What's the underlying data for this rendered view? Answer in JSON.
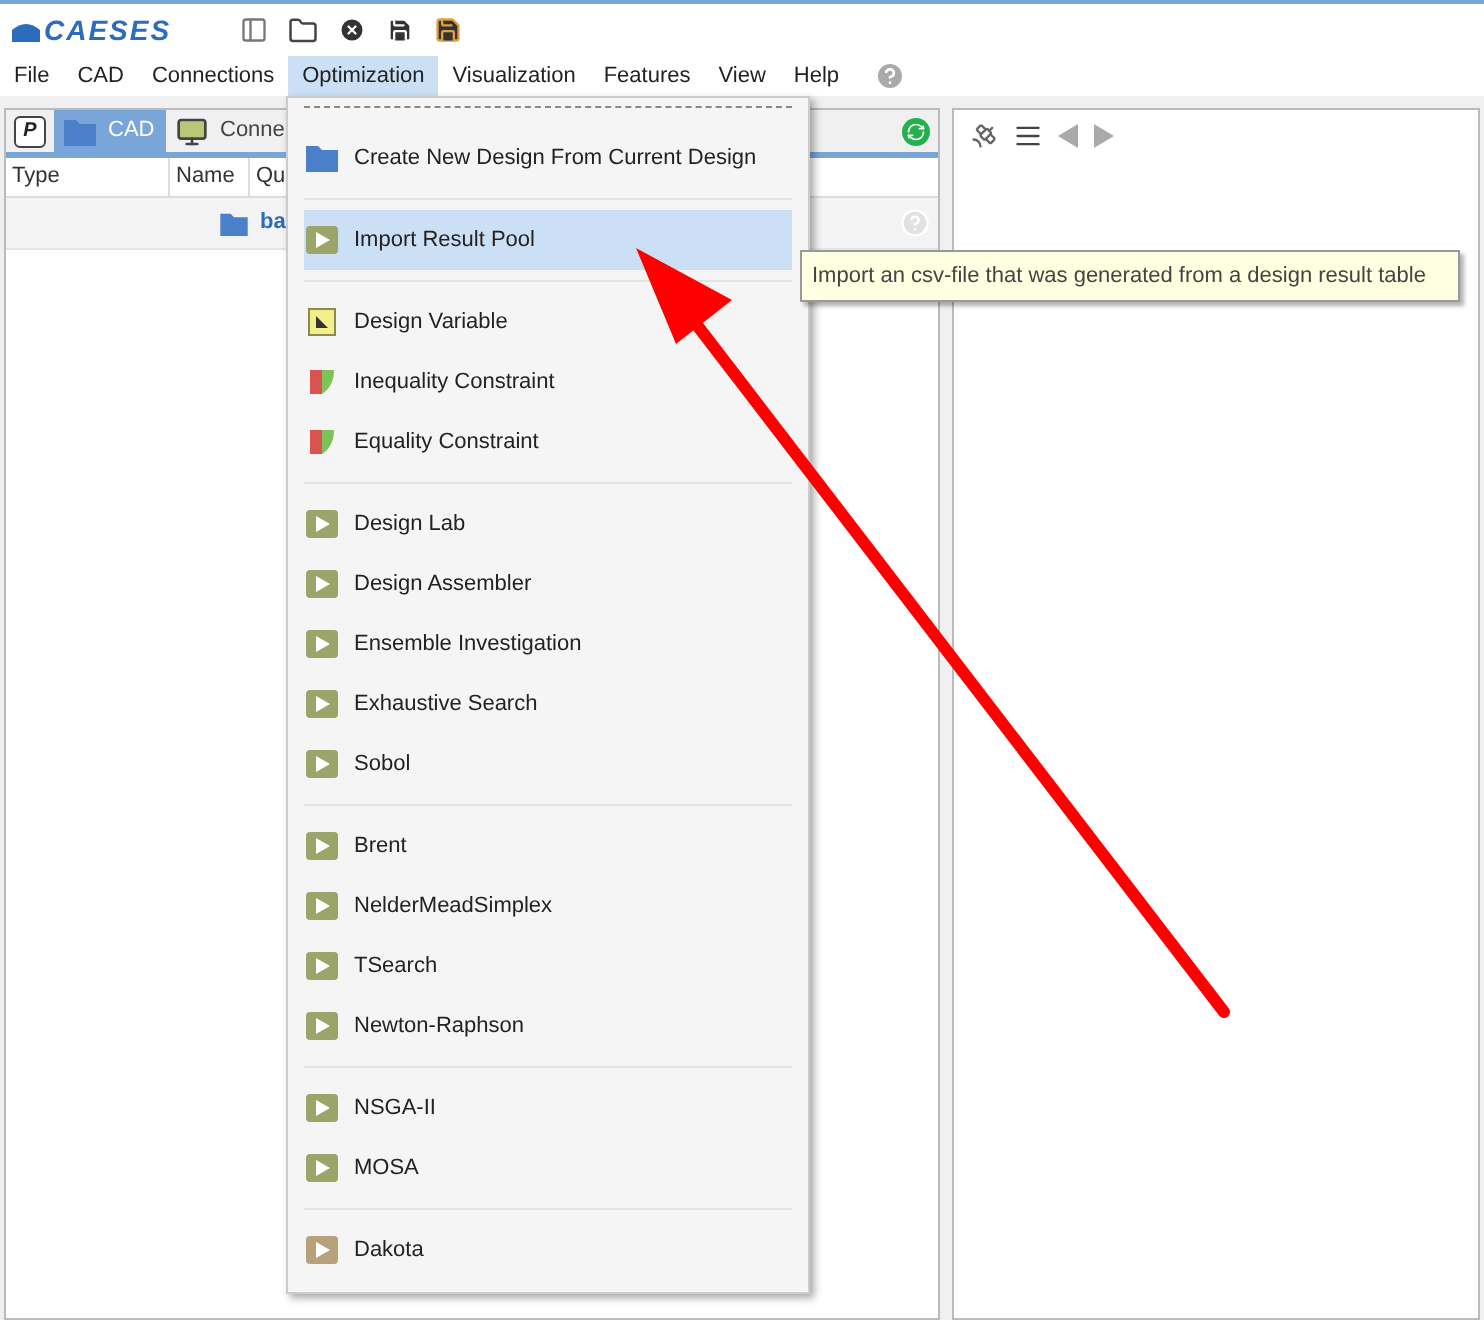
{
  "logo": "CAESES",
  "menubar": [
    {
      "label": "File",
      "selected": false
    },
    {
      "label": "CAD",
      "selected": false
    },
    {
      "label": "Connections",
      "selected": false
    },
    {
      "label": "Optimization",
      "selected": true
    },
    {
      "label": "Visualization",
      "selected": false
    },
    {
      "label": "Features",
      "selected": false
    },
    {
      "label": "View",
      "selected": false
    },
    {
      "label": "Help",
      "selected": false
    }
  ],
  "left_panel": {
    "p_button": "P",
    "tabs": [
      {
        "label": "CAD",
        "selected": true,
        "kind": "folder"
      },
      {
        "label": "Conne",
        "selected": false,
        "kind": "monitor"
      }
    ],
    "columns": [
      "Type",
      "Name",
      "Qu"
    ],
    "rows": [
      {
        "name": "ba"
      }
    ]
  },
  "menu": {
    "groups": [
      [
        {
          "label": "Create New Design From Current Design",
          "kind": "folder",
          "selected": false
        }
      ],
      [
        {
          "label": "Import Result Pool",
          "kind": "play",
          "color": "#9aa56a",
          "selected": true
        }
      ],
      [
        {
          "label": "Design Variable",
          "kind": "variable",
          "selected": false
        },
        {
          "label": "Inequality Constraint",
          "kind": "constraint",
          "selected": false
        },
        {
          "label": "Equality Constraint",
          "kind": "constraint",
          "selected": false
        }
      ],
      [
        {
          "label": "Design Lab",
          "kind": "play",
          "color": "#9aa56a",
          "selected": false
        },
        {
          "label": "Design Assembler",
          "kind": "play",
          "color": "#9aa56a",
          "selected": false
        },
        {
          "label": "Ensemble Investigation",
          "kind": "play",
          "color": "#9aa56a",
          "selected": false
        },
        {
          "label": "Exhaustive Search",
          "kind": "play",
          "color": "#9aa56a",
          "selected": false
        },
        {
          "label": "Sobol",
          "kind": "play",
          "color": "#9aa56a",
          "selected": false
        }
      ],
      [
        {
          "label": "Brent",
          "kind": "play",
          "color": "#9aa56a",
          "selected": false
        },
        {
          "label": "NelderMeadSimplex",
          "kind": "play",
          "color": "#9aa56a",
          "selected": false
        },
        {
          "label": "TSearch",
          "kind": "play",
          "color": "#9aa56a",
          "selected": false
        },
        {
          "label": "Newton-Raphson",
          "kind": "play",
          "color": "#9aa56a",
          "selected": false
        }
      ],
      [
        {
          "label": "NSGA-II",
          "kind": "play",
          "color": "#9aa56a",
          "selected": false
        },
        {
          "label": "MOSA",
          "kind": "play",
          "color": "#9aa56a",
          "selected": false
        }
      ],
      [
        {
          "label": "Dakota",
          "kind": "play",
          "color": "#b7a27c",
          "selected": false
        }
      ]
    ]
  },
  "tooltip": "Import an csv-file that was generated from a design result table"
}
